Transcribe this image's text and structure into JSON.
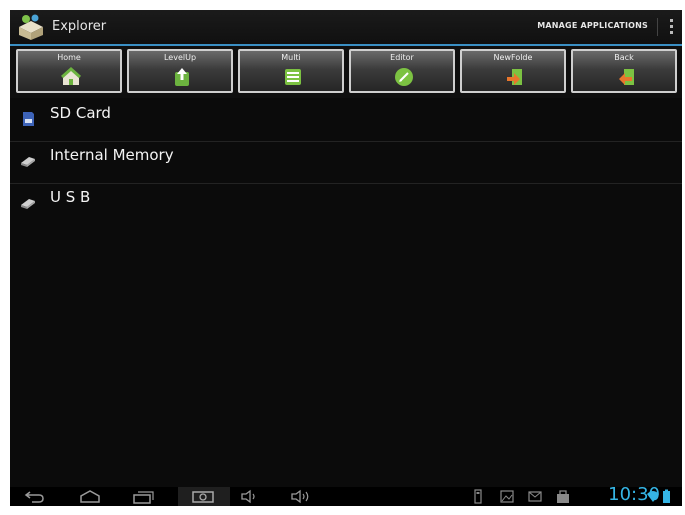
{
  "action_bar": {
    "title": "Explorer",
    "manage_label": "MANAGE APPLICATIONS",
    "app_icon": "explorer-app-icon",
    "overflow_icon": "overflow-menu-icon"
  },
  "toolbar": {
    "buttons": [
      {
        "label": "Home",
        "icon": "home-icon"
      },
      {
        "label": "LevelUp",
        "icon": "level-up-icon"
      },
      {
        "label": "Multi",
        "icon": "multi-select-icon"
      },
      {
        "label": "Editor",
        "icon": "editor-icon"
      },
      {
        "label": "NewFolde",
        "icon": "new-folder-icon"
      },
      {
        "label": "Back",
        "icon": "back-icon"
      }
    ]
  },
  "file_list": {
    "items": [
      {
        "label": "SD Card",
        "icon": "sd-card-icon"
      },
      {
        "label": "Internal Memory",
        "icon": "drive-icon"
      },
      {
        "label": "U S B",
        "icon": "drive-icon"
      }
    ]
  },
  "system_bar": {
    "time": "10:30",
    "nav_icons": [
      "back-nav-icon",
      "home-nav-icon",
      "recents-nav-icon",
      "screenshot-icon",
      "volume-down-icon",
      "volume-up-icon"
    ],
    "status_icons": [
      "usb-icon",
      "image-notification-icon",
      "mail-icon",
      "bag-icon",
      "wifi-icon",
      "battery-icon"
    ],
    "accent_color": "#35b5e5"
  },
  "colors": {
    "background": "#0b0b0b",
    "action_bar_divider": "#3a8fc4"
  }
}
